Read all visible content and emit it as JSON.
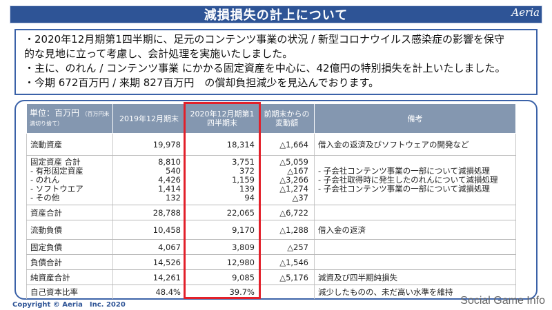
{
  "header": {
    "title": "減損損失の計上について",
    "logo_text": "Aeria"
  },
  "summary": [
    "・2020年12月期第1四半期に、足元のコンテンツ事業の状況 / 新型コロナウイルス感染症の影響を保守",
    "的な見地に立って考慮し、会計処理を実施いたしました。",
    "・主に、のれん / コンテンツ事業 にかかる固定資産を中心に、42億円の特別損失を計上いたしました。",
    "・今期 672百万円  /  来期 827百万円　の償却負担減少を見込んでおります。"
  ],
  "table": {
    "headers": {
      "unit_main": "単位：百万円",
      "unit_note": "（百万円未満切り捨て）",
      "col1": "2019年12月期末",
      "col2": "2020年12月期第1四半期末",
      "col3": "前期末からの変動額",
      "col4": "備考"
    },
    "rows": [
      {
        "name": "流動資産",
        "v2019": "19,978",
        "v2020": "18,314",
        "change": "△1,664",
        "note": "借入金の返済及びソフトウェアの開発など"
      },
      {
        "name": [
          "固定資産 合計",
          " - 有形固定資産",
          " - のれん",
          " - ソフトウエア",
          " - その他"
        ],
        "v2019": [
          "8,810",
          "540",
          "4,426",
          "1,414",
          "132"
        ],
        "v2020": [
          "3,751",
          "372",
          "1,159",
          "139",
          "94"
        ],
        "change": [
          "△5,059",
          "△167",
          "△3,266",
          "△1,274",
          "△37"
        ],
        "note": [
          "",
          "- 子会社コンテンツ事業の一部について減損処理",
          "- 子会社取得時に発生したのれんについて減損処理",
          "- 子会社コンテンツ事業の一部について減損処理",
          ""
        ]
      },
      {
        "name": "資産合計",
        "v2019": "28,788",
        "v2020": "22,065",
        "change": "△6,722",
        "note": ""
      },
      {
        "name": "流動負債",
        "v2019": "10,458",
        "v2020": "9,170",
        "change": "△1,288",
        "note": "借入金の返済"
      },
      {
        "name": "固定負債",
        "v2019": "4,067",
        "v2020": "3,809",
        "change": "△257",
        "note": ""
      },
      {
        "name": "負債合計",
        "v2019": "14,526",
        "v2020": "12,980",
        "change": "△1,546",
        "note": ""
      },
      {
        "name": "純資産合計",
        "v2019": "14,261",
        "v2020": "9,085",
        "change": "△5,176",
        "note": "減資及び四半期純損失"
      },
      {
        "name": "自己資本比率",
        "v2019": "48.4%",
        "v2020": "39.7%",
        "change": "",
        "note": "減少したものの、未だ高い水準を維持"
      }
    ]
  },
  "footer": {
    "copyright": "Copyright © Aeria　Inc. 2020",
    "watermark": "Social Game Info"
  }
}
